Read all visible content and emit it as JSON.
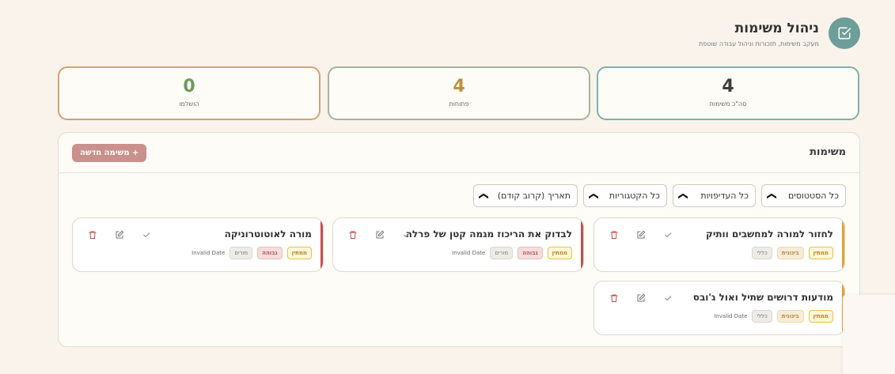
{
  "header": {
    "title": "ניהול משימות",
    "subtitle": "מעקב משימות, תזכורות וניהול עבודה שוטפת"
  },
  "stats": {
    "total": {
      "value": "4",
      "label": "סה\"כ משימות"
    },
    "open": {
      "value": "4",
      "label": "פתוחות"
    },
    "done": {
      "value": "0",
      "label": "הושלמו"
    }
  },
  "panel": {
    "title": "משימות",
    "new_task_label": "+ משימה חדשה"
  },
  "filters": {
    "status": "כל הסטטוסים",
    "priority": "כל העדיפויות",
    "category": "כל הקטגוריות",
    "sort": "תאריך (קרוב קודם)"
  },
  "tasks": [
    {
      "title": "לחזור למורה למחשבים וותיק",
      "status": "ממתין",
      "priority": "בינונית",
      "category": "כללי",
      "date": ""
    },
    {
      "title": "לבדוק את הריכוז מגמה קטן של פרלה",
      "status": "ממתין",
      "priority": "גבוהה",
      "category": "מורים",
      "date": "Invalid Date"
    },
    {
      "title": "מורה לאוטוטרוניקה",
      "status": "ממתין",
      "priority": "גבוהה",
      "category": "מורים",
      "date": "Invalid Date"
    },
    {
      "title": "מודעות דרושים שתיל ואול ג'ובס",
      "status": "ממתין",
      "priority": "בינונית",
      "category": "כללי",
      "date": "Invalid Date"
    }
  ],
  "colors": {
    "accent": "#6d9e9a",
    "high": "#c0504d",
    "medium": "#e8a030",
    "new_button": "#c9908c"
  }
}
